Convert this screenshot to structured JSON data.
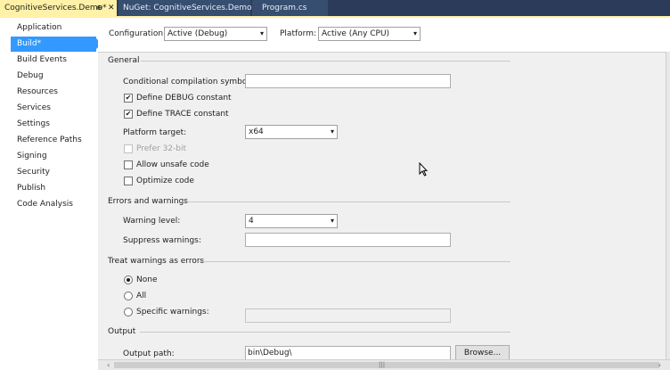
{
  "tabs": {
    "active": "CognitiveServices.Demo*",
    "active_pin": "⊕",
    "active_close": "✕",
    "nuget": "NuGet: CognitiveServices.Demo",
    "program": "Program.cs"
  },
  "sidebar": {
    "items": [
      "Application",
      "Build*",
      "Build Events",
      "Debug",
      "Resources",
      "Services",
      "Settings",
      "Reference Paths",
      "Signing",
      "Security",
      "Publish",
      "Code Analysis"
    ]
  },
  "top": {
    "configuration_label": "Configuration:",
    "configuration_value": "Active (Debug)",
    "platform_label": "Platform:",
    "platform_value": "Active (Any CPU)"
  },
  "general": {
    "title": "General",
    "cond_symbols_label": "Conditional compilation symbols:",
    "cond_symbols_value": "",
    "define_debug": "Define DEBUG constant",
    "define_trace": "Define TRACE constant",
    "platform_target_label": "Platform target:",
    "platform_target_value": "x64",
    "prefer32": "Prefer 32-bit",
    "allow_unsafe": "Allow unsafe code",
    "optimize": "Optimize code"
  },
  "errors": {
    "title": "Errors and warnings",
    "warning_level_label": "Warning level:",
    "warning_level_value": "4",
    "suppress_label": "Suppress warnings:",
    "suppress_value": ""
  },
  "treat": {
    "title": "Treat warnings as errors",
    "none": "None",
    "all": "All",
    "specific": "Specific warnings:",
    "specific_value": ""
  },
  "output": {
    "title": "Output",
    "path_label": "Output path:",
    "path_value": "bin\\Debug\\",
    "browse": "Browse..."
  },
  "symbols": {
    "check": "✔",
    "dropdown": "▾",
    "scroll_left": "‹",
    "scroll_right": "›",
    "grip": "|||"
  }
}
